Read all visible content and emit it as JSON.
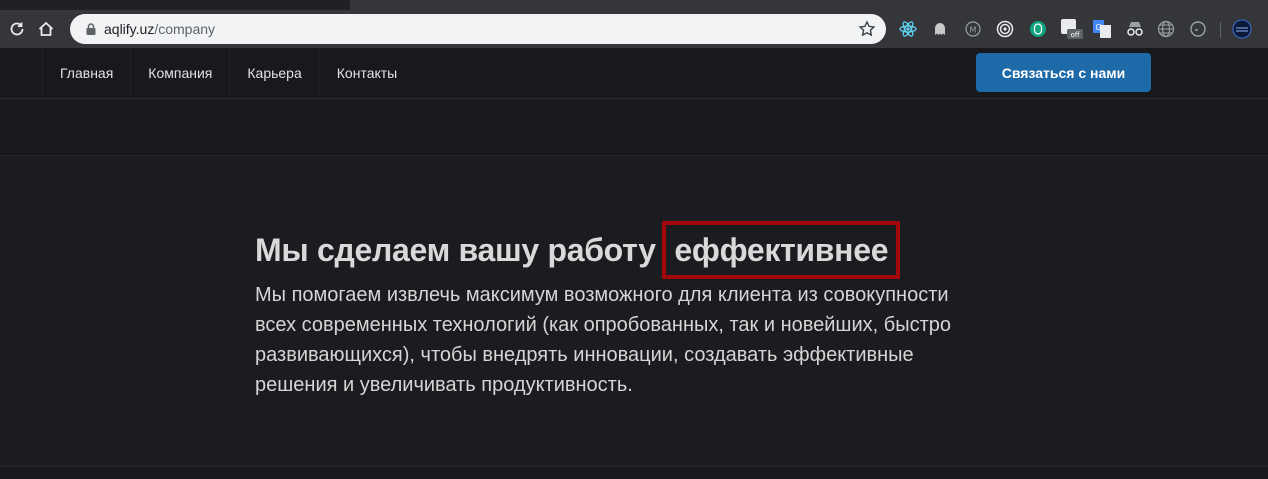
{
  "browser": {
    "url_host": "aqlify.uz",
    "url_path": "/company",
    "extensions": [
      "react-devtools-icon",
      "ghost-icon",
      "m-circle-icon",
      "target-icon",
      "chatgpt-icon",
      "off-badge-icon",
      "translate-icon",
      "spy-glasses-icon",
      "globe-icon",
      "clock-icon",
      "black-lake-icon"
    ],
    "off_badge": "off"
  },
  "nav": {
    "links": [
      "Главная",
      "Компания",
      "Карьера",
      "Контакты"
    ],
    "cta_label": "Связаться с нами"
  },
  "hero": {
    "headline_main": "Мы сделаем вашу работу",
    "headline_highlight": "еффективнее",
    "lead": "Мы помогаем извлечь максимум возможного для клиента из совокупности всех современных технологий (как опробованных, так и новейших, быстро развивающихся), чтобы внедрять инновации, создавать эффективные решения и увеличивать продуктивность."
  },
  "colors": {
    "background": "#18191c",
    "cta": "#1e6aa8",
    "highlight_border": "#a3070c"
  }
}
